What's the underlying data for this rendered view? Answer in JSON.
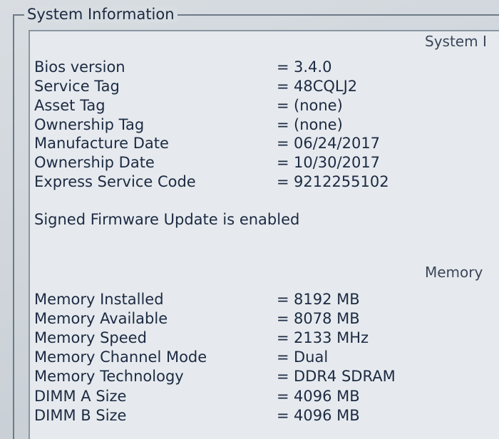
{
  "groupbox": {
    "title": "System Information"
  },
  "system_section": {
    "header": "System I",
    "rows": [
      {
        "label": "Bios version",
        "value": "3.4.0"
      },
      {
        "label": "Service Tag",
        "value": "48CQLJ2"
      },
      {
        "label": "Asset Tag",
        "value": "(none)"
      },
      {
        "label": "Ownership Tag",
        "value": "(none)"
      },
      {
        "label": "Manufacture Date",
        "value": "06/24/2017"
      },
      {
        "label": "Ownership Date",
        "value": "10/30/2017"
      },
      {
        "label": "Express Service Code",
        "value": "9212255102"
      }
    ],
    "status": "Signed Firmware Update is enabled"
  },
  "memory_section": {
    "header": "Memory",
    "rows": [
      {
        "label": "Memory Installed",
        "value": "8192 MB"
      },
      {
        "label": "Memory Available",
        "value": "8078 MB"
      },
      {
        "label": "Memory Speed",
        "value": "2133 MHz"
      },
      {
        "label": "Memory Channel Mode",
        "value": "Dual"
      },
      {
        "label": "Memory Technology",
        "value": "DDR4 SDRAM"
      },
      {
        "label": "DIMM A Size",
        "value": "4096 MB"
      },
      {
        "label": "DIMM B Size",
        "value": "4096 MB"
      }
    ]
  },
  "separator": "="
}
